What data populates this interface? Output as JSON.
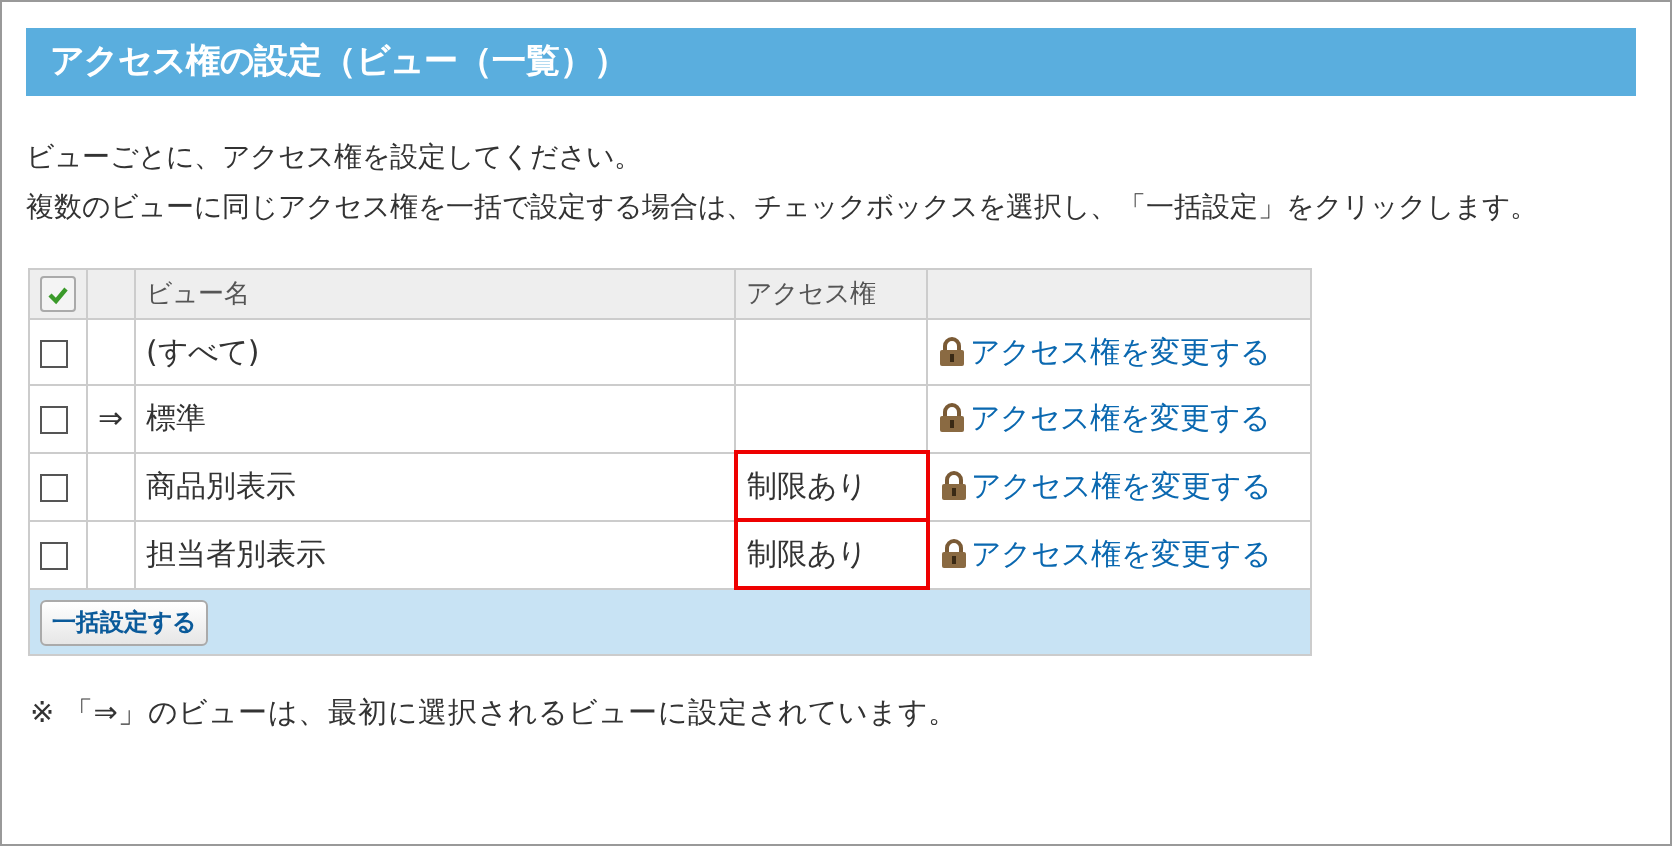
{
  "title": "アクセス権の設定（ビュー（一覧））",
  "description": [
    "ビューごとに、アクセス権を設定してください。",
    "複数のビューに同じアクセス権を一括で設定する場合は、チェックボックスを選択し、「一括設定」をクリックします。"
  ],
  "table": {
    "select_all": {
      "checked": true
    },
    "columns": [
      "ビュー名",
      "アクセス権"
    ],
    "rows": [
      {
        "checked": false,
        "marker": "",
        "name": "(すべて)",
        "access": "",
        "highlighted": false,
        "action": "アクセス権を変更する"
      },
      {
        "checked": false,
        "marker": "⇒",
        "name": "標準",
        "access": "",
        "highlighted": false,
        "action": "アクセス権を変更する"
      },
      {
        "checked": false,
        "marker": "",
        "name": "商品別表示",
        "access": "制限あり",
        "highlighted": true,
        "action": "アクセス権を変更する"
      },
      {
        "checked": false,
        "marker": "",
        "name": "担当者別表示",
        "access": "制限あり",
        "highlighted": true,
        "action": "アクセス権を変更する"
      }
    ],
    "bulk_button": "一括設定する"
  },
  "note": "※ 「⇒」のビューは、最初に選択されるビューに設定されています。"
}
